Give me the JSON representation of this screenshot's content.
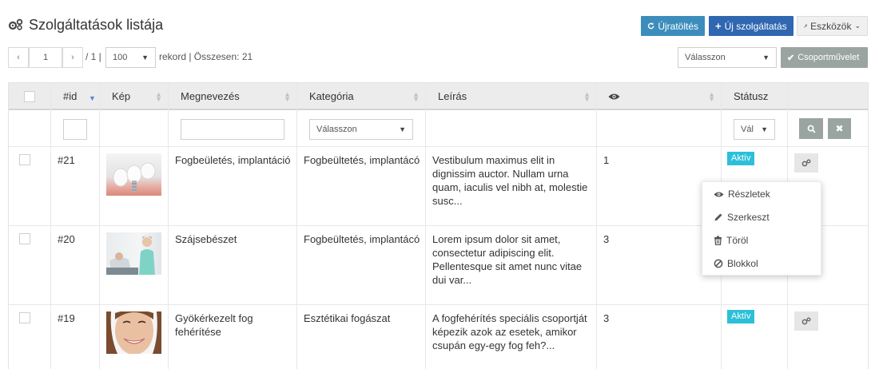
{
  "header": {
    "title": "Szolgáltatások listája",
    "title_icon": "gears-icon",
    "buttons": {
      "reload": "Újratöltés",
      "new_service": "Új szolgáltatás",
      "tools": "Eszközök"
    }
  },
  "pagination": {
    "prev": "‹",
    "page": "1",
    "next": "›",
    "of_pages": "/ 1 |",
    "per_page": "100",
    "summary": "rekord | Összesen: 21",
    "bulk_select": "Válasszon",
    "bulk_button": "Csoportművelet"
  },
  "table": {
    "columns": {
      "id": "#id",
      "image": "Kép",
      "name": "Megnevezés",
      "category": "Kategória",
      "description": "Leírás",
      "views_icon": "eye-icon",
      "status": "Státusz"
    },
    "filters": {
      "category_select": "Válasszon",
      "status_select": "Vál"
    },
    "rows": [
      {
        "id": "#21",
        "name": "Fogbeületés, implantáció",
        "category": "Fogbeültetés, implantácó",
        "description": "Vestibulum maximus elit in dignissim auctor. Nullam urna quam, iaculis vel nibh at, molestie susc...",
        "views": "1",
        "status": "Aktív"
      },
      {
        "id": "#20",
        "name": "Szájsebészet",
        "category": "Fogbeültetés, implantácó",
        "description": "Lorem ipsum dolor sit amet, consectetur adipiscing elit. Pellentesque sit amet nunc vitae dui var...",
        "views": "3",
        "status": ""
      },
      {
        "id": "#19",
        "name": "Gyökérkezelt fog fehérítése",
        "category": "Esztétikai fogászat",
        "description": "A fogfehérítés speciális csoportját képezik azok az esetek, amikor csupán egy-egy fog feh?...",
        "views": "3",
        "status": "Aktív"
      }
    ]
  },
  "action_menu": {
    "details": "Részletek",
    "edit": "Szerkeszt",
    "delete": "Töröl",
    "block": "Blokkol"
  },
  "colors": {
    "primary": "#3c8dbc",
    "primary_dark": "#2f67b1",
    "status_active": "#2bc0d8",
    "header_bg": "#ececec"
  }
}
